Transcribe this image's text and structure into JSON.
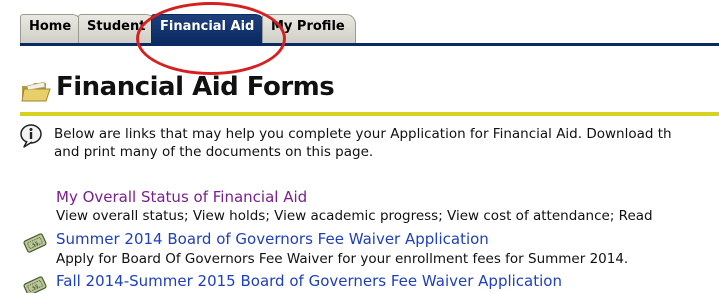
{
  "tabs": [
    {
      "label": "Home",
      "active": false
    },
    {
      "label": "Student",
      "active": false
    },
    {
      "label": "Financial Aid",
      "active": true
    },
    {
      "label": "My Profile",
      "active": false
    }
  ],
  "page": {
    "title": "Financial Aid Forms",
    "intro_line1": "Below are links that may help you complete your Application for Financial Aid. Download th",
    "intro_line2": "and print many of the documents on this page."
  },
  "items": [
    {
      "link": "My Overall Status of Financial Aid",
      "description": "View overall status; View holds; View academic progress; View cost of attendance; Read"
    },
    {
      "link": "Summer 2014 Board of Governors Fee Waiver Application",
      "description": "Apply for Board Of Governors Fee Waiver for your enrollment fees for Summer 2014."
    },
    {
      "link": "Fall 2014-Summer 2015 Board of Governers Fee Waiver Application",
      "description": ""
    }
  ],
  "colors": {
    "tab_active": "#0a2a63",
    "link": "#1e3fbe",
    "visited_link": "#7a1f8f",
    "title_rule": "#d6d31e",
    "highlight_ring": "#d62020"
  },
  "icons": {
    "page_title": "folder-icon",
    "intro": "info-icon",
    "fee_waiver": "coupon-icon"
  }
}
